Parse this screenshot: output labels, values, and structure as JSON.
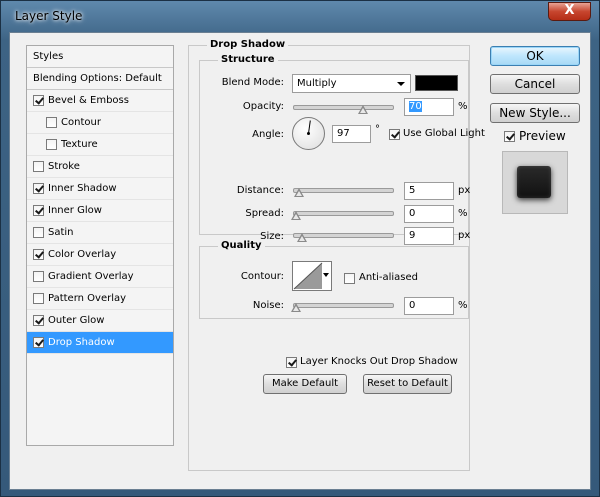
{
  "window": {
    "title": "Layer Style",
    "close_glyph": "X"
  },
  "styles_panel": {
    "header_styles": "Styles",
    "header_blending": "Blending Options: Default",
    "items": [
      {
        "label": "Bevel & Emboss",
        "checked": true
      },
      {
        "label": "Contour",
        "checked": false
      },
      {
        "label": "Texture",
        "checked": false
      },
      {
        "label": "Stroke",
        "checked": false
      },
      {
        "label": "Inner Shadow",
        "checked": true
      },
      {
        "label": "Inner Glow",
        "checked": true
      },
      {
        "label": "Satin",
        "checked": false
      },
      {
        "label": "Color Overlay",
        "checked": true
      },
      {
        "label": "Gradient Overlay",
        "checked": false
      },
      {
        "label": "Pattern Overlay",
        "checked": false
      },
      {
        "label": "Outer Glow",
        "checked": true
      },
      {
        "label": "Drop Shadow",
        "checked": true,
        "selected": true
      }
    ]
  },
  "drop_shadow": {
    "section_title": "Drop Shadow",
    "structure_title": "Structure",
    "blend_mode_label": "Blend Mode:",
    "blend_mode_value": "Multiply",
    "shadow_color": "#000000",
    "opacity_label": "Opacity:",
    "opacity_value": "70",
    "opacity_unit": "%",
    "angle_label": "Angle:",
    "angle_value": "97",
    "angle_unit": "°",
    "use_global_light_label": "Use Global Light",
    "use_global_light_checked": true,
    "distance_label": "Distance:",
    "distance_value": "5",
    "distance_unit": "px",
    "spread_label": "Spread:",
    "spread_value": "0",
    "spread_unit": "%",
    "size_label": "Size:",
    "size_value": "9",
    "size_unit": "px",
    "quality_title": "Quality",
    "contour_label": "Contour:",
    "anti_aliased_label": "Anti-aliased",
    "anti_aliased_checked": false,
    "noise_label": "Noise:",
    "noise_value": "0",
    "noise_unit": "%",
    "knocks_out_label": "Layer Knocks Out Drop Shadow",
    "knocks_out_checked": true,
    "make_default_label": "Make Default",
    "reset_default_label": "Reset to Default"
  },
  "right_panel": {
    "ok_label": "OK",
    "cancel_label": "Cancel",
    "new_style_label": "New Style...",
    "preview_label": "Preview",
    "preview_checked": true
  }
}
